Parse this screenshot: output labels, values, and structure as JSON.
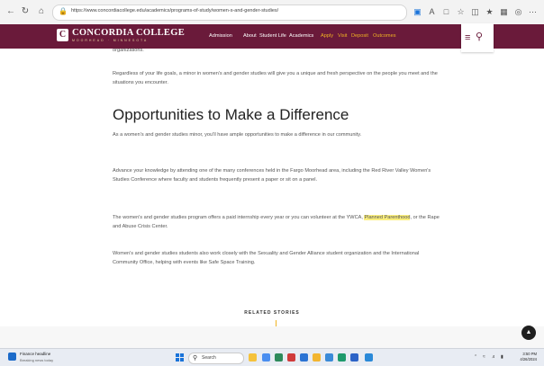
{
  "browser": {
    "url": "https://www.concordiacollege.edu/academics/programs-of-study/women-s-and-gender-studies/"
  },
  "site": {
    "logo_name": "CONCORDIA COLLEGE",
    "logo_sub": "MOORHEAD · MINNESOTA",
    "logo_mark": "C",
    "menu_white": [
      "Admission",
      "About",
      "Student Life",
      "Academics"
    ],
    "menu_gold": [
      "Apply",
      "Visit",
      "Deposit",
      "Outcomes"
    ],
    "accent_color": "#6a1a3a",
    "gold_color": "#f0b323"
  },
  "content": {
    "intro_tail": "organizations.",
    "intro_p": "Regardless of your life goals, a minor in women's and gender studies will give you a unique and fresh perspective on the people you meet and the situations you encounter.",
    "heading": "Opportunities to Make a Difference",
    "p1": "As a women's and gender studies minor, you'll have ample opportunities to make a difference in our community.",
    "p2": "Advance your knowledge by attending one of the many conferences held in the Fargo Moorhead area, including the Red River Valley Women's Studies Conference where faculty and students frequently present a paper or sit on a panel.",
    "p3_a": "The women's and gender studies program offers a paid internship every year or you can volunteer at the YWCA,",
    "p3_link": "Planned Parenthood",
    "p3_b": ", or the Rape and Abuse Crisis Center.",
    "p4": "Women's and gender studies students also work closely with the Sexuality and Gender Alliance student organization and the International Community Office, helping with events like Safe Space Training.",
    "related": "RELATED STORIES"
  },
  "taskbar": {
    "news_title": "Finance headline",
    "news_sub": "Breaking news today",
    "search_label": "Search",
    "time": "3:50 PM",
    "date": "4/26/2024"
  }
}
